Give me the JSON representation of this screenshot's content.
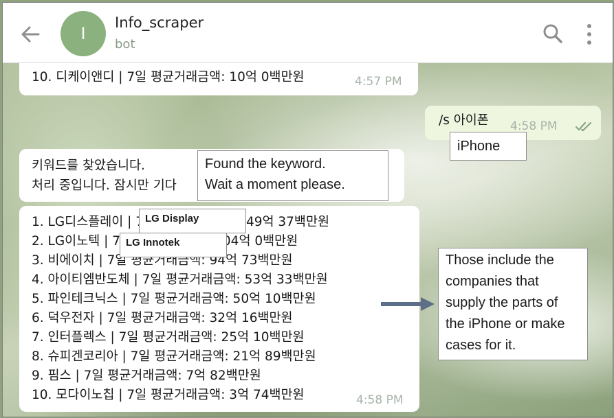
{
  "header": {
    "title": "Info_scraper",
    "subtitle": "bot",
    "avatar_letter": "I"
  },
  "messages": {
    "top_partial": {
      "text": "10. 디케이앤디 | 7일 평균거래금액: 10억 0백만원",
      "time": "4:57 PM"
    },
    "outgoing": {
      "text": "/s 아이폰",
      "time": "4:58 PM"
    },
    "status": {
      "line1": "키워드를 찾았습니다.",
      "line2": "처리 중입니다. 잠시만 기다"
    },
    "results": {
      "lines": [
        "1. LG디스플레이 | 7일 평균거래금액: 849억 37백만원",
        "2. LG이노텍 | 7일 평균거래금액: 804억 0백만원",
        "3. 비에이치 | 7일 평균거래금액: 94억 73백만원",
        "4. 아이티엠반도체 | 7일 평균거래금액: 53억 33백만원",
        "5. 파인테크닉스 | 7일 평균거래금액: 50억 10백만원",
        "6. 덕우전자 | 7일 평균거래금액: 32억 16백만원",
        "7. 인터플렉스 | 7일 평균거래금액: 25억 10백만원",
        "8. 슈피겐코리아 | 7일 평균거래금액: 21억 89백만원",
        "9. 핌스 | 7일 평균거래금액: 7억 82백만원",
        "10. 모다이노칩 | 7일 평균거래금액: 3억 74백만원"
      ],
      "time": "4:58 PM"
    }
  },
  "annotations": {
    "iphone": "iPhone",
    "found": {
      "line1": "Found the keyword.",
      "line2": "Wait a moment please."
    },
    "lg_display": "LG Display",
    "lg_innotek": "LG Innotek",
    "explanation": [
      "Those include the",
      "companies that",
      "supply the parts of",
      "the iPhone or make",
      "cases for it."
    ]
  },
  "colors": {
    "avatar": "#8ab17e",
    "outgoing_bubble": "#eef6df",
    "read_check": "#8aa48c",
    "arrow": "#5c6f86"
  },
  "icons": [
    "back-arrow-icon",
    "search-icon",
    "more-vert-icon",
    "double-check-icon",
    "right-arrow-icon"
  ]
}
